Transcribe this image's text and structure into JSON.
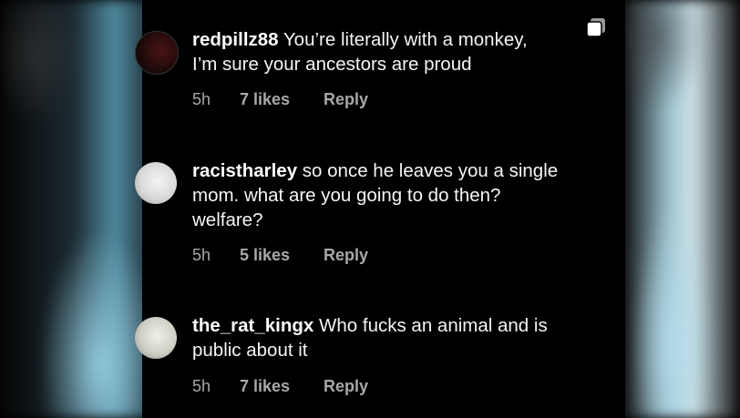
{
  "comments": [
    {
      "username": "redpillz88",
      "text_line1": " You’re literally with a monkey,",
      "text_line2": "I’m sure your ancestors are proud",
      "text_line3": "",
      "time": "5h",
      "likes": "7 likes",
      "reply": "Reply",
      "avatar_icon": "profile-avatar-dark"
    },
    {
      "username": "racistharley",
      "text_line1": " so once he leaves you a single",
      "text_line2": "mom.  what are you going to do then?",
      "text_line3": "welfare?",
      "time": "5h",
      "likes": "5 likes",
      "reply": "Reply",
      "avatar_icon": "profile-avatar-light"
    },
    {
      "username": "the_rat_kingx",
      "text_line1": " Who f",
      "text_censored": "ucks",
      "text_line1_rest": " an animal and is",
      "text_line2": "public about it",
      "text_line3": "",
      "time": "5h",
      "likes": "7 likes",
      "reply": "Reply",
      "avatar_icon": "profile-avatar-light"
    }
  ],
  "copy_icon": "copy-icon"
}
